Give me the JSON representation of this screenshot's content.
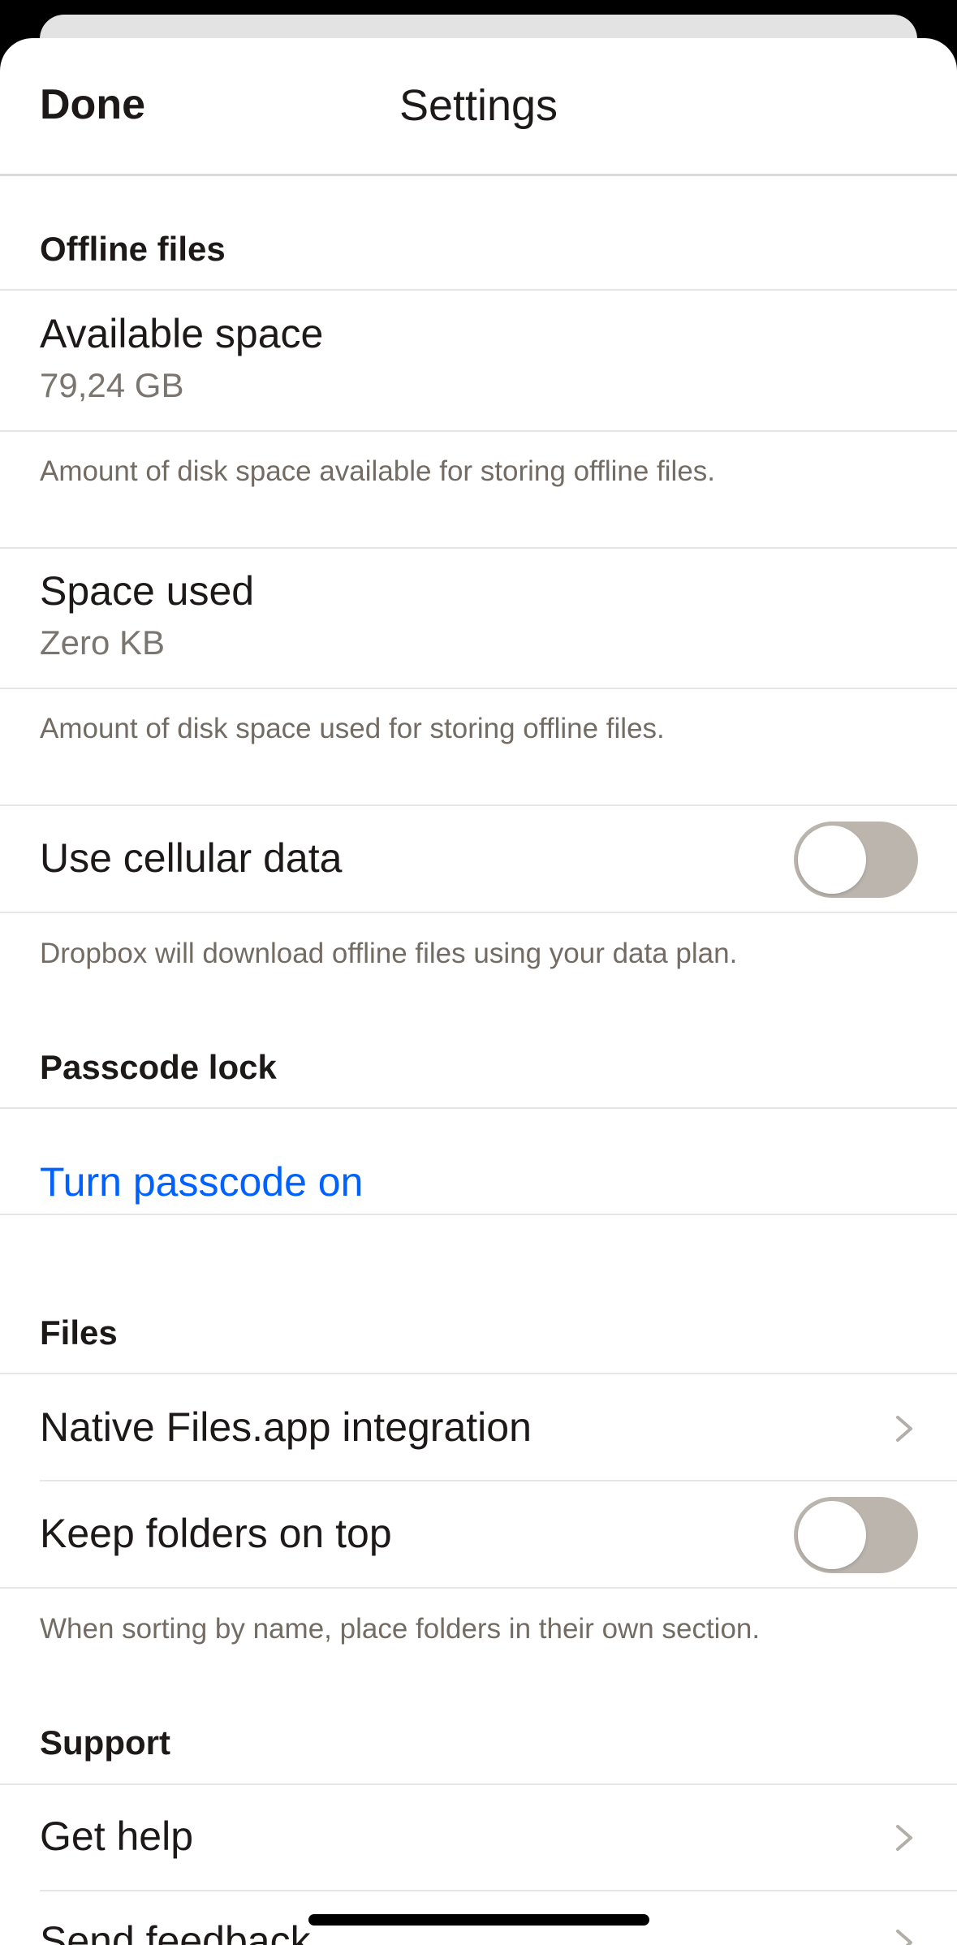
{
  "header": {
    "done_label": "Done",
    "title": "Settings"
  },
  "offline_files": {
    "section_title": "Offline files",
    "available_space": {
      "title": "Available space",
      "value": "79,24 GB",
      "footnote": "Amount of disk space available for storing offline files."
    },
    "space_used": {
      "title": "Space used",
      "value": "Zero KB",
      "footnote": "Amount of disk space used for storing offline files."
    },
    "cellular": {
      "title": "Use cellular data",
      "enabled": false,
      "footnote": "Dropbox will download offline files using your data plan."
    }
  },
  "passcode": {
    "section_title": "Passcode lock",
    "action_label": "Turn passcode on",
    "action_color": "#0061fe"
  },
  "files": {
    "section_title": "Files",
    "native_integration": {
      "title": "Native Files.app integration",
      "icon": "chevron-right-icon"
    },
    "folders_on_top": {
      "title": "Keep folders on top",
      "enabled": false,
      "footnote": "When sorting by name, place folders in their own section."
    }
  },
  "support": {
    "section_title": "Support",
    "get_help": {
      "title": "Get help",
      "icon": "chevron-right-icon"
    },
    "send_feedback": {
      "title": "Send feedback",
      "icon": "chevron-right-icon"
    }
  }
}
